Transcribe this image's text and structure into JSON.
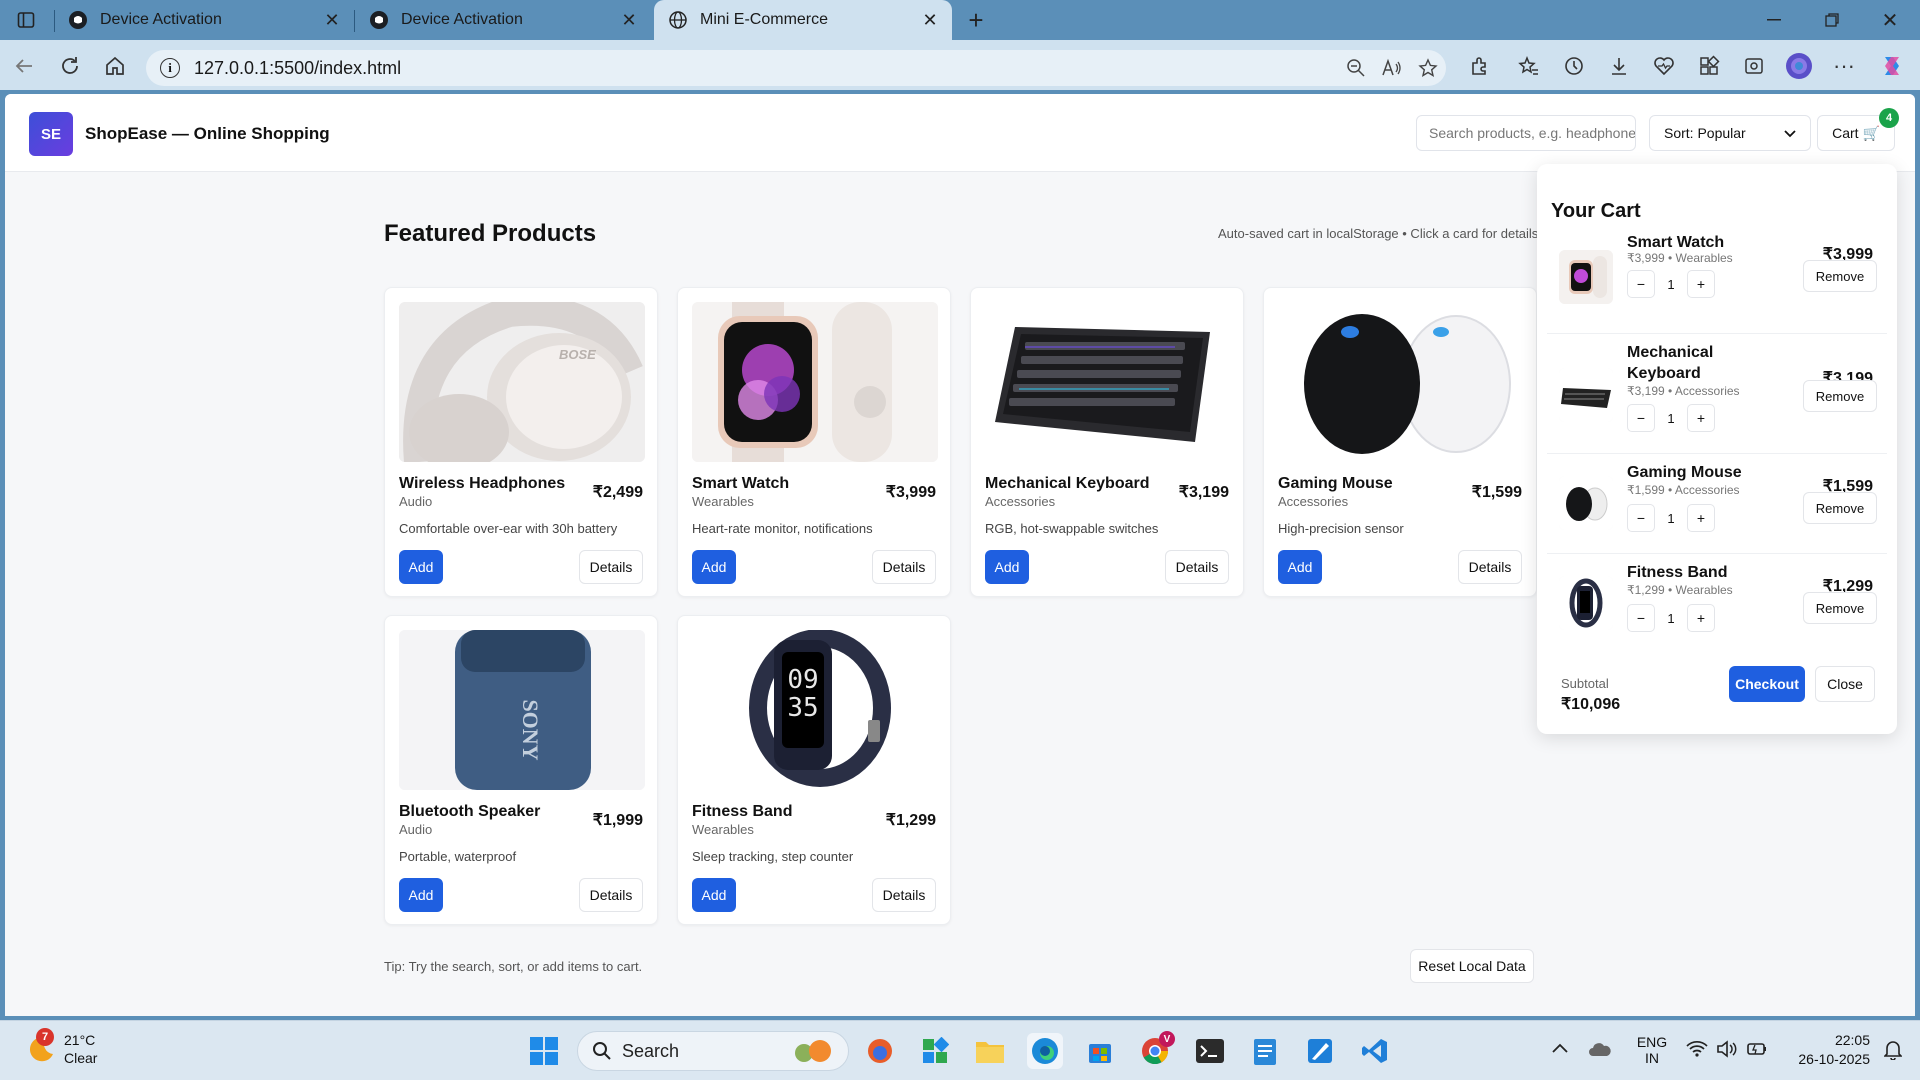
{
  "browser": {
    "tabs": [
      {
        "title": "Device Activation",
        "icon": "github-icon"
      },
      {
        "title": "Device Activation",
        "icon": "github-icon"
      },
      {
        "title": "Mini E-Commerce",
        "icon": "globe-icon"
      }
    ],
    "url": "127.0.0.1:5500/index.html"
  },
  "header": {
    "logo": "SE",
    "brand": "ShopEase — Online Shopping",
    "search_placeholder": "Search products, e.g. headphones",
    "sort_label": "Sort: Popular",
    "cart_label": "Cart 🛒",
    "cart_count": "4"
  },
  "main": {
    "title": "Featured Products",
    "note": "Auto-saved cart in localStorage • Click a card for details",
    "add_label": "Add",
    "details_label": "Details",
    "products": [
      {
        "name": "Wireless Headphones",
        "category": "Audio",
        "price": "₹2,499",
        "desc": "Comfortable over-ear with 30h battery"
      },
      {
        "name": "Smart Watch",
        "category": "Wearables",
        "price": "₹3,999",
        "desc": "Heart-rate monitor, notifications"
      },
      {
        "name": "Mechanical Keyboard",
        "category": "Accessories",
        "price": "₹3,199",
        "desc": "RGB, hot-swappable switches"
      },
      {
        "name": "Gaming Mouse",
        "category": "Accessories",
        "price": "₹1,599",
        "desc": "High-precision sensor"
      },
      {
        "name": "Bluetooth Speaker",
        "category": "Audio",
        "price": "₹1,999",
        "desc": "Portable, waterproof"
      },
      {
        "name": "Fitness Band",
        "category": "Wearables",
        "price": "₹1,299",
        "desc": "Sleep tracking, step counter"
      }
    ],
    "tip": "Tip: Try the search, sort, or add items to cart.",
    "reset_label": "Reset Local Data",
    "speaker_brand": "SONY",
    "headphone_brand": "BOSE",
    "band_time": [
      "09",
      "35"
    ]
  },
  "cart": {
    "title": "Your Cart",
    "remove_label": "Remove",
    "minus": "−",
    "plus": "+",
    "items": [
      {
        "name": "Smart Watch",
        "meta": "₹3,999 • Wearables",
        "price": "₹3,999",
        "qty": "1"
      },
      {
        "name": "Mechanical Keyboard",
        "meta": "₹3,199 • Accessories",
        "price": "₹3,199",
        "qty": "1"
      },
      {
        "name": "Gaming Mouse",
        "meta": "₹1,599 • Accessories",
        "price": "₹1,599",
        "qty": "1"
      },
      {
        "name": "Fitness Band",
        "meta": "₹1,299 • Wearables",
        "price": "₹1,299",
        "qty": "1"
      }
    ],
    "subtotal_label": "Subtotal",
    "subtotal": "₹10,096",
    "checkout_label": "Checkout",
    "close_label": "Close"
  },
  "taskbar": {
    "weather_temp": "21°C",
    "weather_cond": "Clear",
    "weather_badge": "7",
    "search_label": "Search",
    "lang1": "ENG",
    "lang2": "IN",
    "time": "22:05",
    "date": "26-10-2025",
    "chrome_badge": "V"
  }
}
